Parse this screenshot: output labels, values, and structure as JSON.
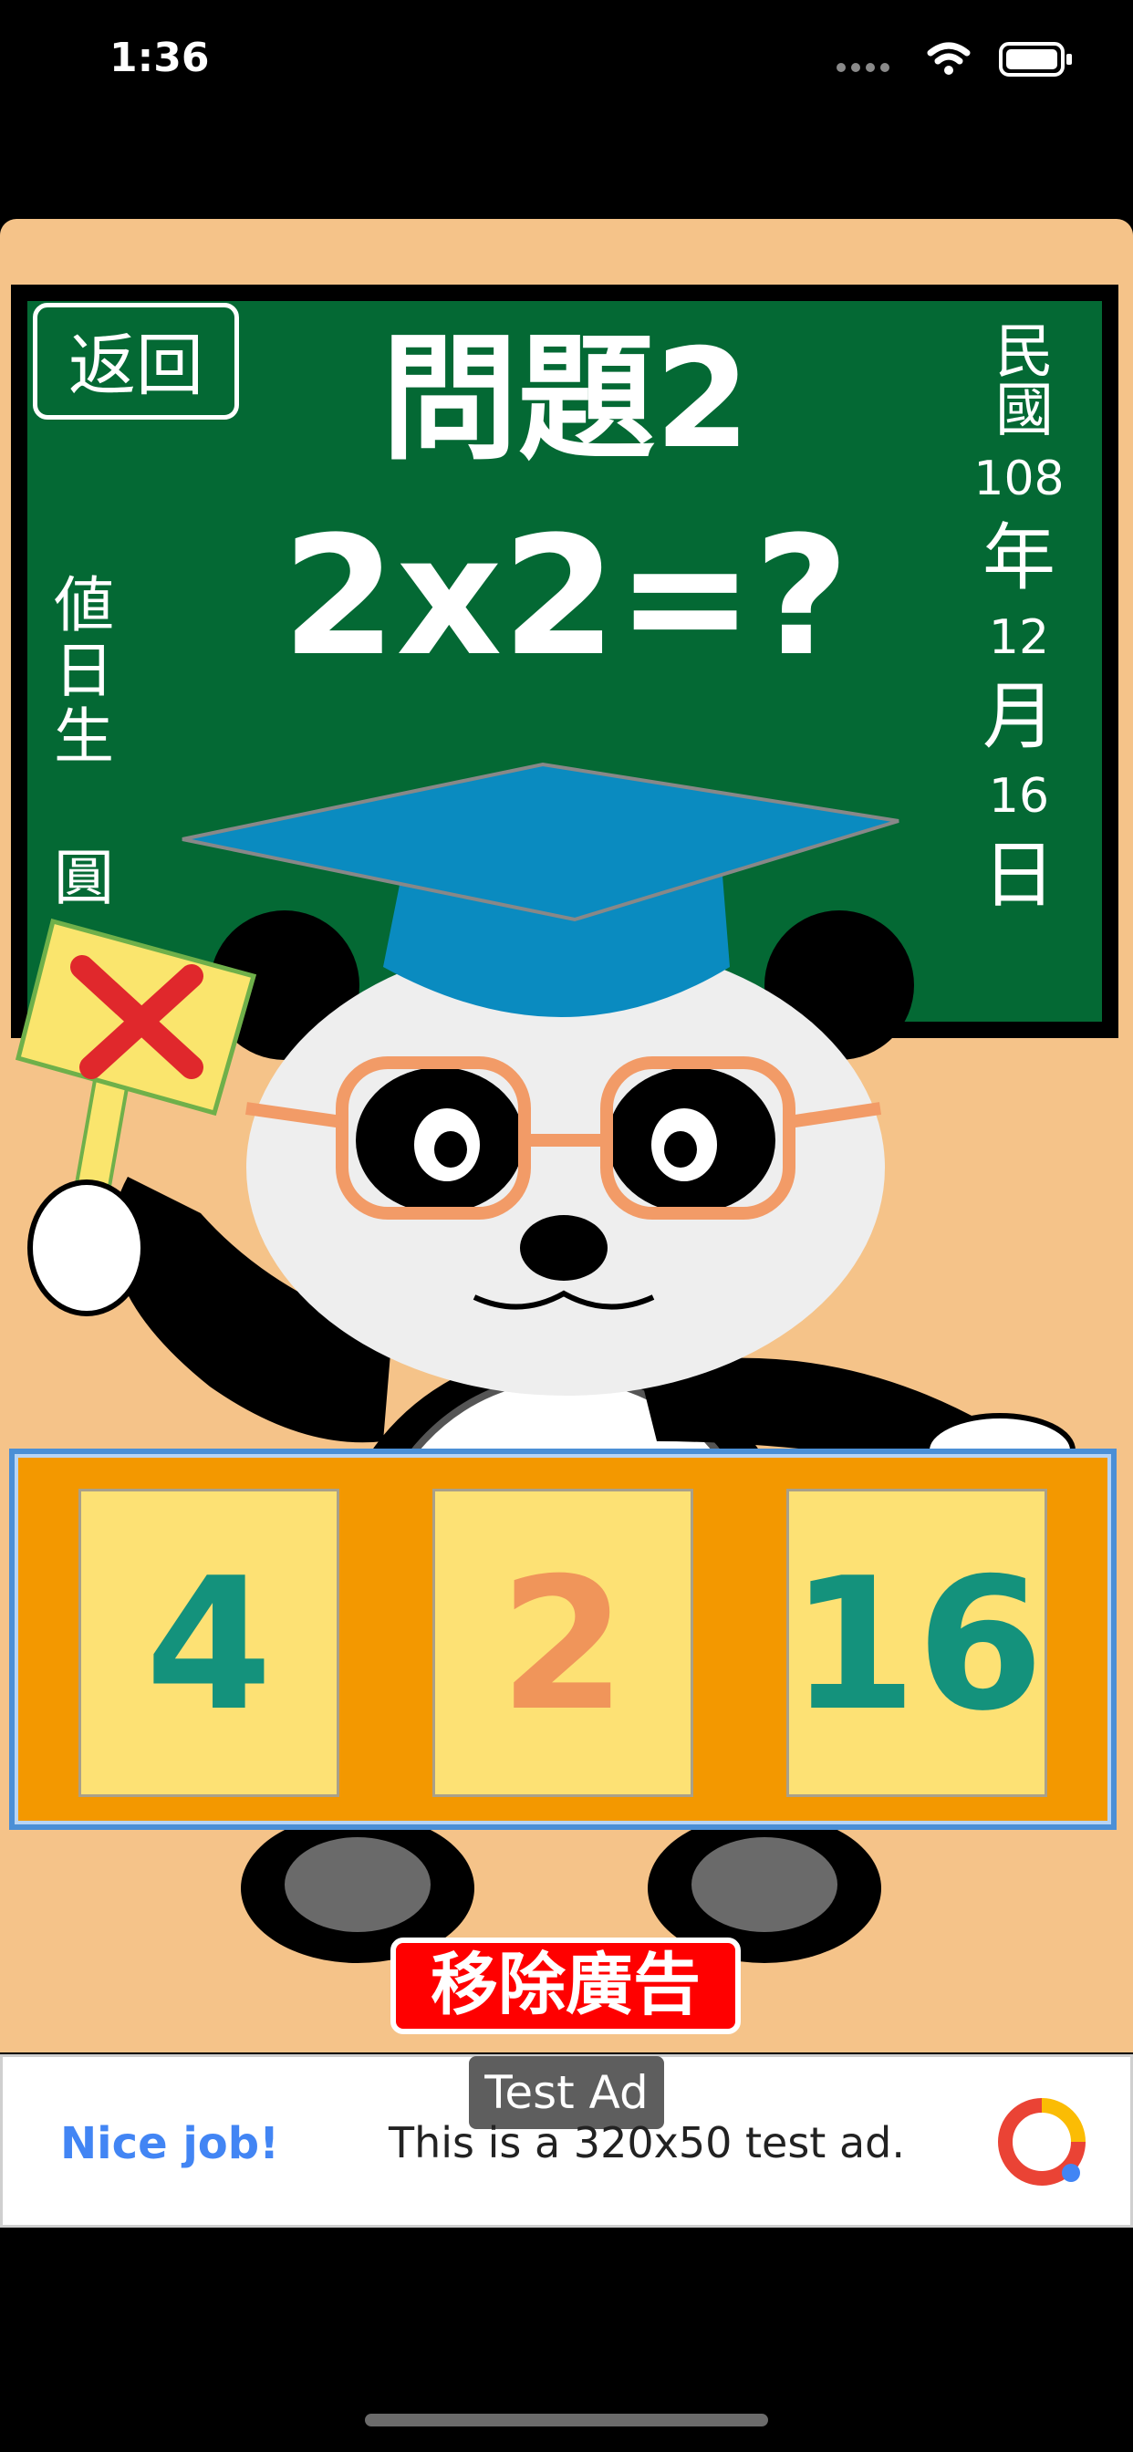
{
  "status": {
    "time": "1:36"
  },
  "board": {
    "back_label": "返回",
    "question_title": "問題2",
    "question_expr": "2x2=?",
    "duty_text": "値日生 圓",
    "date": {
      "era": "民國",
      "year": "108",
      "year_unit": "年",
      "month": "12",
      "month_unit": "月",
      "day": "16",
      "day_unit": "日"
    }
  },
  "sign": {
    "icon": "cross-icon",
    "color": "#e0282c"
  },
  "answers": [
    {
      "value": "4",
      "color": "#14927c"
    },
    {
      "value": "2",
      "color": "#f0955a"
    },
    {
      "value": "16",
      "color": "#14927c"
    }
  ],
  "remove_ad_label": "移除廣告",
  "ad": {
    "tag": "Test Ad",
    "cta": "Nice job!",
    "text": "This is a 320x50 test ad."
  },
  "colors": {
    "background": "#f5c389",
    "chalkboard": "#046934",
    "panel": "#f39800",
    "card": "#fde174"
  }
}
